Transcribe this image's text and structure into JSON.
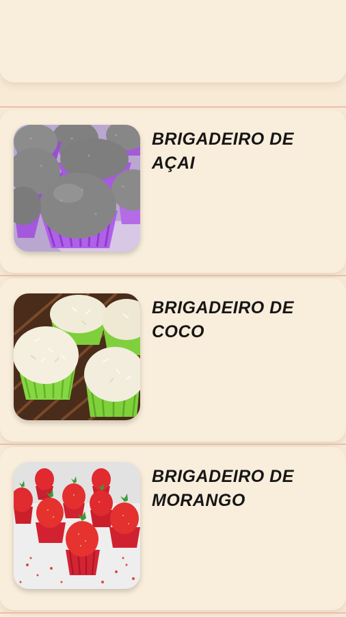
{
  "recipes": [
    {
      "title": "BRIGADEIRO DE AÇAI",
      "image": "acai-brigadeiro-photo"
    },
    {
      "title": "BRIGADEIRO DE COCO",
      "image": "coconut-brigadeiro-photo"
    },
    {
      "title": "BRIGADEIRO DE MORANGO",
      "image": "strawberry-brigadeiro-photo"
    }
  ],
  "colors": {
    "background": "#f8ebd6",
    "card": "#f9eddb",
    "divider": "#ecbcb0",
    "title": "#161616"
  }
}
